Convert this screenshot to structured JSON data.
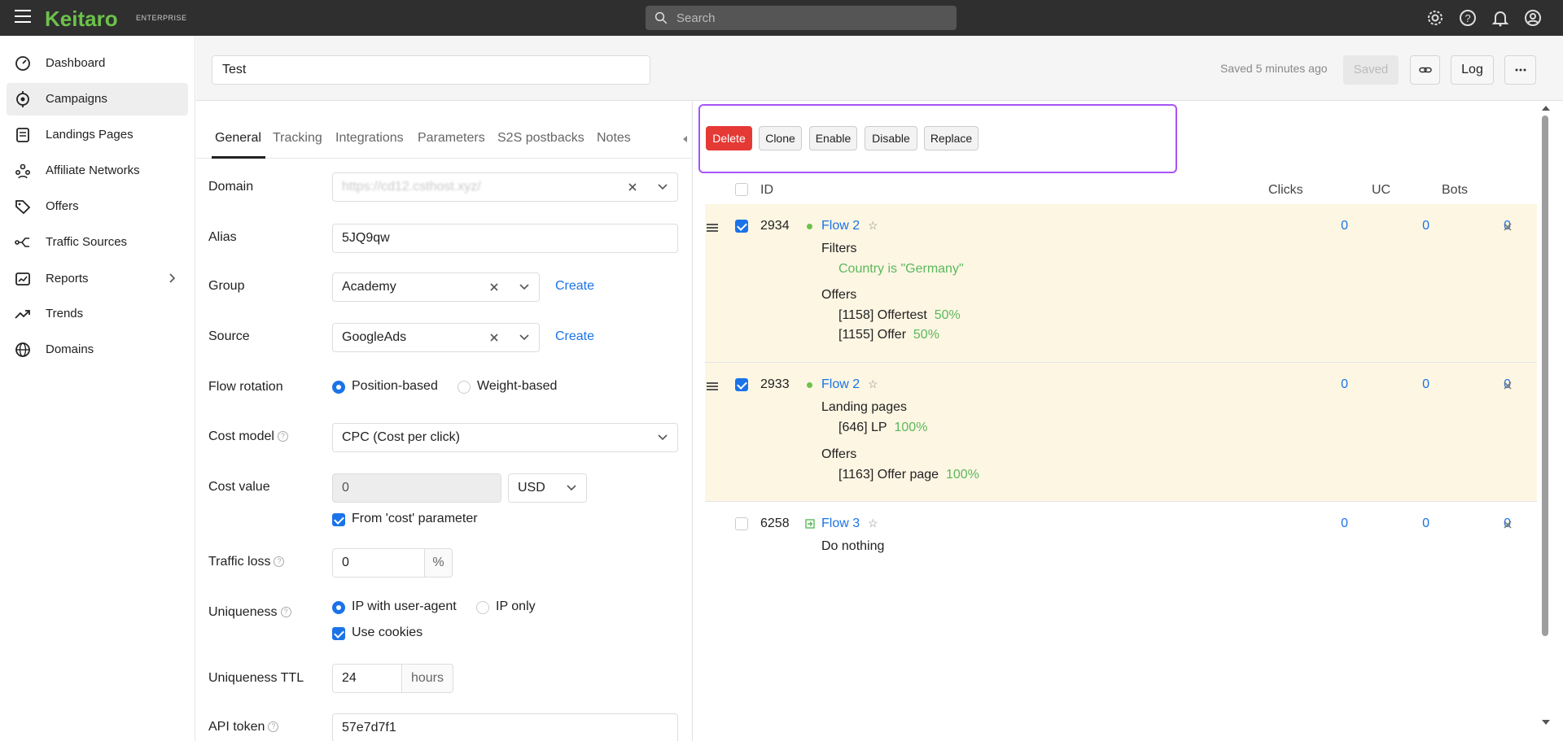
{
  "app": {
    "logo": "Keitaro",
    "edition": "ENTERPRISE"
  },
  "search": {
    "placeholder": "Search"
  },
  "top_icons": [
    "settings-icon",
    "help-icon",
    "bell-icon",
    "user-icon"
  ],
  "sidebar": {
    "items": [
      {
        "label": "Dashboard",
        "icon": "dashboard-icon"
      },
      {
        "label": "Campaigns",
        "icon": "target-icon",
        "active": true
      },
      {
        "label": "Landings Pages",
        "icon": "document-icon"
      },
      {
        "label": "Affiliate Networks",
        "icon": "network-icon"
      },
      {
        "label": "Offers",
        "icon": "tag-icon"
      },
      {
        "label": "Traffic Sources",
        "icon": "traffic-icon"
      },
      {
        "label": "Reports",
        "icon": "chart-icon",
        "has_submenu": true
      },
      {
        "label": "Trends",
        "icon": "trend-icon"
      },
      {
        "label": "Domains",
        "icon": "globe-icon"
      }
    ]
  },
  "header": {
    "campaign_name": "Test",
    "saved_status": "Saved 5 minutes ago",
    "saved_button": "Saved",
    "log_button": "Log"
  },
  "tabs": [
    "General",
    "Tracking",
    "Integrations",
    "Parameters",
    "S2S postbacks",
    "Notes"
  ],
  "form": {
    "domain_label": "Domain",
    "domain_value": "https://cd12.csthost.xyz/",
    "alias_label": "Alias",
    "alias_value": "5JQ9qw",
    "group_label": "Group",
    "group_value": "Academy",
    "create_label": "Create",
    "source_label": "Source",
    "source_value": "GoogleAds",
    "flow_rotation_label": "Flow rotation",
    "flow_rotation_options": [
      "Position-based",
      "Weight-based"
    ],
    "cost_model_label": "Cost model",
    "cost_model_value": "CPC (Cost per click)",
    "cost_value_label": "Cost value",
    "cost_value": "0",
    "currency": "USD",
    "from_cost_param": "From 'cost' parameter",
    "traffic_loss_label": "Traffic loss",
    "traffic_loss_value": "0",
    "percent": "%",
    "uniqueness_label": "Uniqueness",
    "uniqueness_options": [
      "IP with user-agent",
      "IP only"
    ],
    "use_cookies": "Use cookies",
    "uniqueness_ttl_label": "Uniqueness TTL",
    "uniqueness_ttl_value": "24",
    "hours": "hours",
    "api_token_label": "API token",
    "api_token_value": "57e7d7f1"
  },
  "bulk_actions": [
    "Delete",
    "Clone",
    "Enable",
    "Disable",
    "Replace"
  ],
  "table": {
    "headers": {
      "id": "ID",
      "clicks": "Clicks",
      "uc": "UC",
      "bots": "Bots"
    },
    "rows": [
      {
        "id": "2934",
        "name": "Flow 2",
        "selected": true,
        "status": "active",
        "clicks": "0",
        "uc": "0",
        "bots": "0",
        "filters_label": "Filters",
        "filter": "Country is \"Germany\"",
        "offers_label": "Offers",
        "offers": [
          {
            "name": "[1158] Offertest",
            "share": "50%"
          },
          {
            "name": "[1155] Offer",
            "share": "50%"
          }
        ]
      },
      {
        "id": "2933",
        "name": "Flow 2",
        "selected": true,
        "status": "active",
        "clicks": "0",
        "uc": "0",
        "bots": "0",
        "landings_label": "Landing pages",
        "landings": [
          {
            "name": "[646] LP",
            "share": "100%"
          }
        ],
        "offers_label": "Offers",
        "offers": [
          {
            "name": "[1163] Offer page",
            "share": "100%"
          }
        ]
      },
      {
        "id": "6258",
        "name": "Flow 3",
        "selected": false,
        "status": "forced",
        "clicks": "0",
        "uc": "0",
        "bots": "0",
        "action": "Do nothing"
      }
    ]
  },
  "colors": {
    "accent": "#1a73e8",
    "brand": "#6cc24a",
    "danger": "#e53935",
    "highlight": "#a855f7"
  }
}
